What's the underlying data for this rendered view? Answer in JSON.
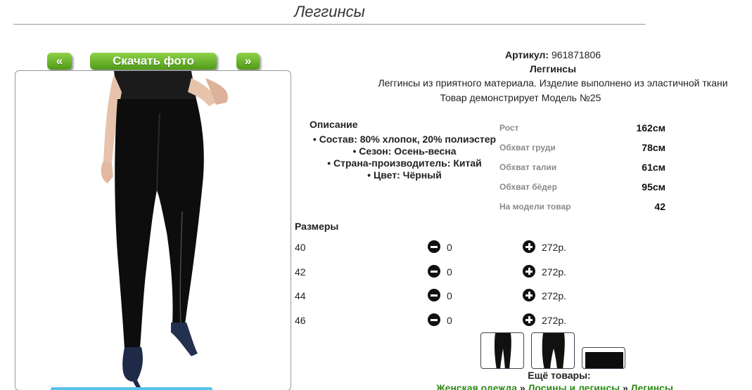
{
  "page": {
    "title": "Леггинсы"
  },
  "gallery": {
    "prev_label": "«",
    "download_label": "Скачать фото",
    "next_label": "»"
  },
  "product": {
    "article_label": "Артикул:",
    "article_value": "961871806",
    "name": "Леггинсы",
    "description": "Леггинсы из приятного материала. Изделие выполнено из эластичной ткани",
    "model_note": "Товар демонстрирует Модель №25"
  },
  "description": {
    "heading": "Описание",
    "items": [
      "Состав: 80% хлопок, 20% полиэстер",
      "Сезон: Осень-весна",
      "Страна-производитель: Китай",
      "Цвет: Чёрный"
    ]
  },
  "model_params": [
    {
      "label": "Рост",
      "value": "162см"
    },
    {
      "label": "Обхват груди",
      "value": "78см"
    },
    {
      "label": "Обхват талии",
      "value": "61см"
    },
    {
      "label": "Обхват бёдер",
      "value": "95см"
    },
    {
      "label": "На модели товар",
      "value": "42"
    }
  ],
  "sizes": {
    "heading": "Размеры",
    "rows": [
      {
        "size": "40",
        "qty": "0",
        "price": "272р."
      },
      {
        "size": "42",
        "qty": "0",
        "price": "272р."
      },
      {
        "size": "44",
        "qty": "0",
        "price": "272р."
      },
      {
        "size": "46",
        "qty": "0",
        "price": "272р."
      }
    ]
  },
  "more": {
    "heading": "Ещё товары:",
    "breadcrumb": [
      "Женская одежда",
      "Лосины и легинсы",
      "Легинсы"
    ],
    "separator": "»"
  },
  "icons": {
    "minus": "minus-circle-icon",
    "plus": "plus-circle-icon"
  },
  "colors": {
    "button_green": "#5aa81e",
    "link_green": "#2a8a12"
  }
}
